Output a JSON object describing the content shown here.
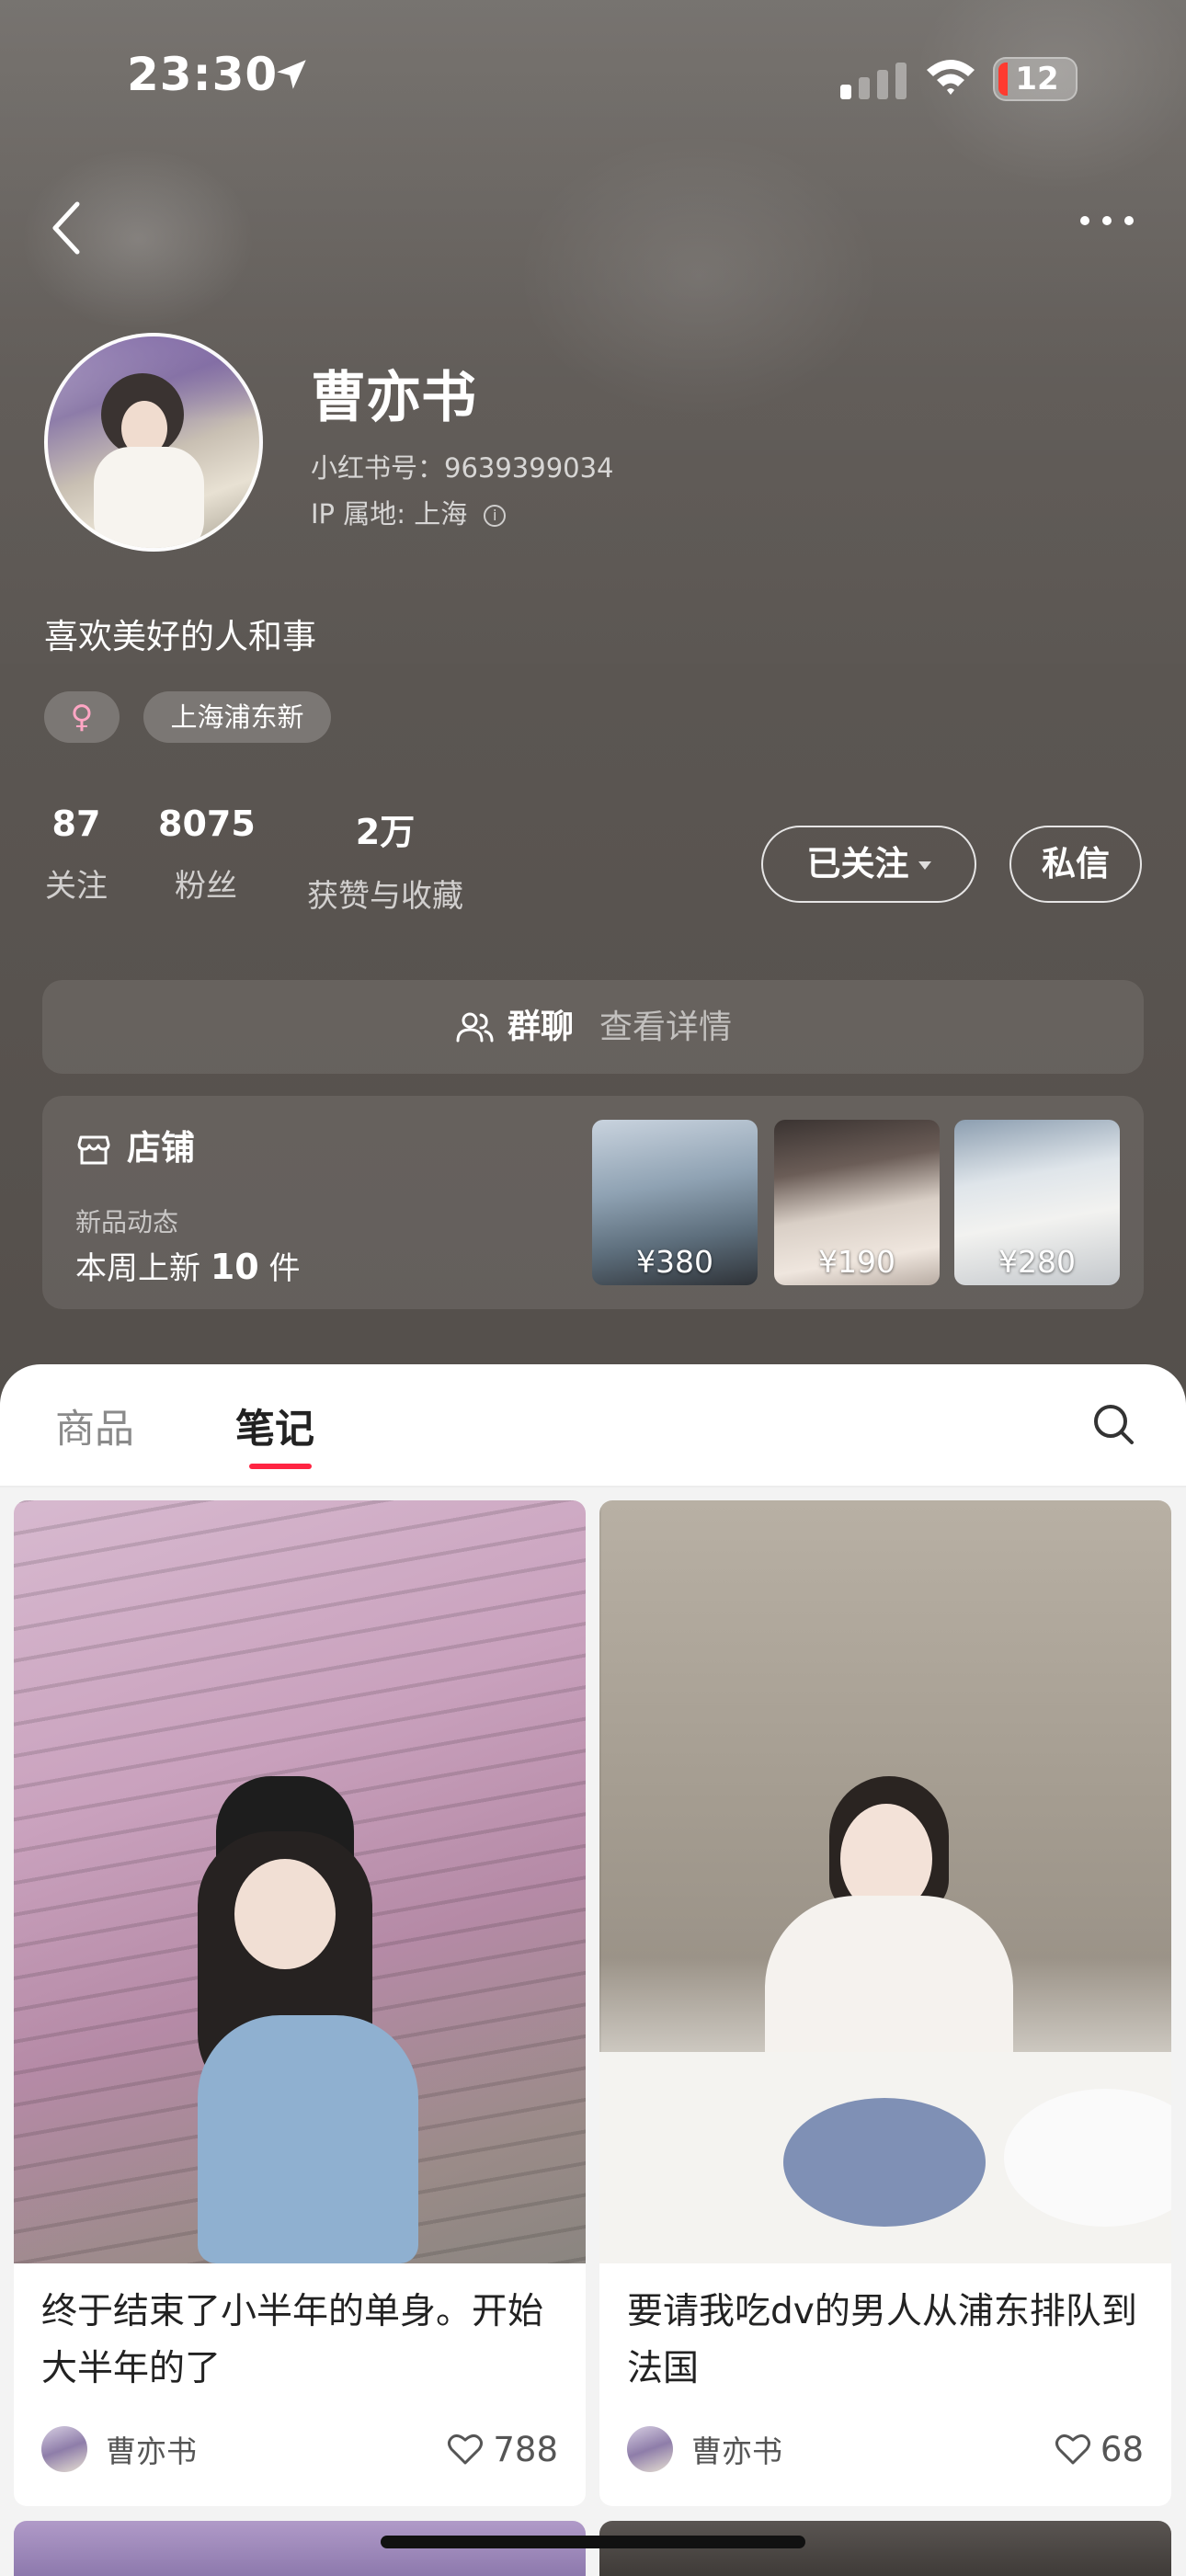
{
  "status_bar": {
    "time": "23:30",
    "battery": "12"
  },
  "profile": {
    "nickname": "曹亦书",
    "user_id": "小红书号：9639399034",
    "ip_location": "IP 属地: 上海",
    "bio": "喜欢美好的人和事",
    "tags": {
      "gender": "♀",
      "location": "上海浦东新"
    },
    "stats": [
      {
        "value": "87",
        "label": "关注"
      },
      {
        "value": "8075",
        "label": "粉丝"
      },
      {
        "value": "2万",
        "label": "获赞与收藏"
      }
    ],
    "follow_button": "已关注",
    "message_button": "私信"
  },
  "group_chat": {
    "title": "群聊",
    "detail": "查看详情"
  },
  "shop": {
    "title": "店铺",
    "subtitle": "新品动态",
    "new_prefix": "本周上新",
    "new_count": "10",
    "new_suffix": "件",
    "products": [
      {
        "price": "¥380"
      },
      {
        "price": "¥190"
      },
      {
        "price": "¥280"
      }
    ]
  },
  "tabs": {
    "goods": "商品",
    "notes": "笔记",
    "active": "笔记"
  },
  "notes": [
    {
      "title": "终于结束了小半年的单身。开始大半年的了",
      "author": "曹亦书",
      "likes": "788"
    },
    {
      "title": "要请我吃dv的男人从浦东排队到法国",
      "author": "曹亦书",
      "likes": "68"
    }
  ],
  "colors": {
    "accent": "#ff2442",
    "header_bg": "#5a5551"
  }
}
